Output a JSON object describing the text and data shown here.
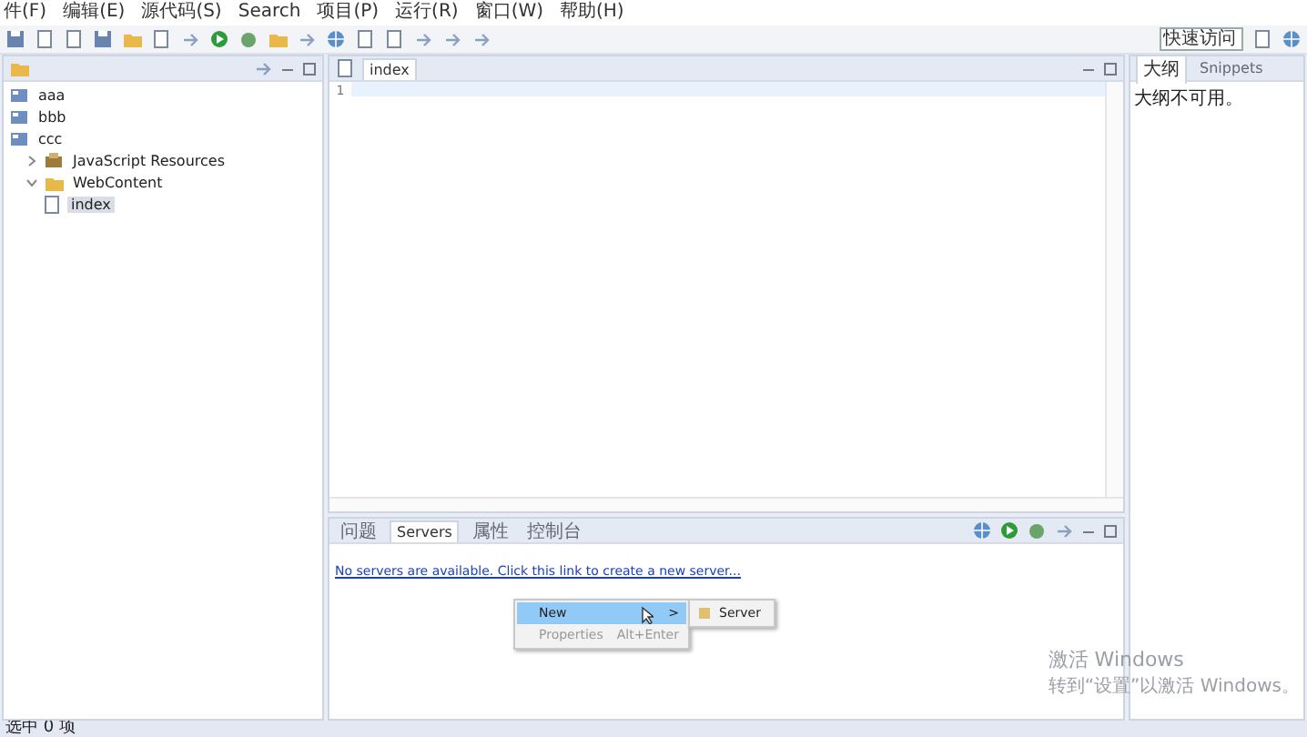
{
  "menu": [
    "件(F)",
    "编辑(E)",
    "源代码(S)",
    "Search",
    "项目(P)",
    "运行(R)",
    "窗口(W)",
    "帮助(H)"
  ],
  "quick_access": {
    "placeholder": "快速访问"
  },
  "explorer": {
    "tree": [
      {
        "label": "aaa",
        "kind": "project"
      },
      {
        "label": "bbb",
        "kind": "project"
      },
      {
        "label": "ccc",
        "kind": "project",
        "children": [
          {
            "label": "JavaScript Resources",
            "kind": "library",
            "expanded": false
          },
          {
            "label": "WebContent",
            "kind": "folder",
            "expanded": true,
            "children": [
              {
                "label": "index",
                "kind": "file",
                "selected": true
              }
            ]
          }
        ]
      }
    ]
  },
  "editor": {
    "tab": "index",
    "line_numbers": [
      "1"
    ]
  },
  "outline": {
    "tabs": [
      {
        "label": "大纲",
        "selected": true
      },
      {
        "label": "Snippets",
        "selected": false
      }
    ],
    "message": "大纲不可用。"
  },
  "servers": {
    "tabs": [
      {
        "label": "问题",
        "selected": false
      },
      {
        "label": "Servers",
        "selected": true
      },
      {
        "label": "属性",
        "selected": false
      },
      {
        "label": "控制台",
        "selected": false
      }
    ],
    "link": "No servers are available. Click this link to create a new server..."
  },
  "context_menu": {
    "items": [
      {
        "label": "New",
        "shortcut": ">",
        "selected": true,
        "disabled": false
      },
      {
        "label": "Properties",
        "shortcut": "Alt+Enter",
        "selected": false,
        "disabled": true
      }
    ],
    "submenu": [
      {
        "label": "Server"
      }
    ]
  },
  "windows_activation": {
    "title": "激活 Windows",
    "text": "转到“设置”以激活 Windows。"
  },
  "status_bar": "选中 0 项"
}
